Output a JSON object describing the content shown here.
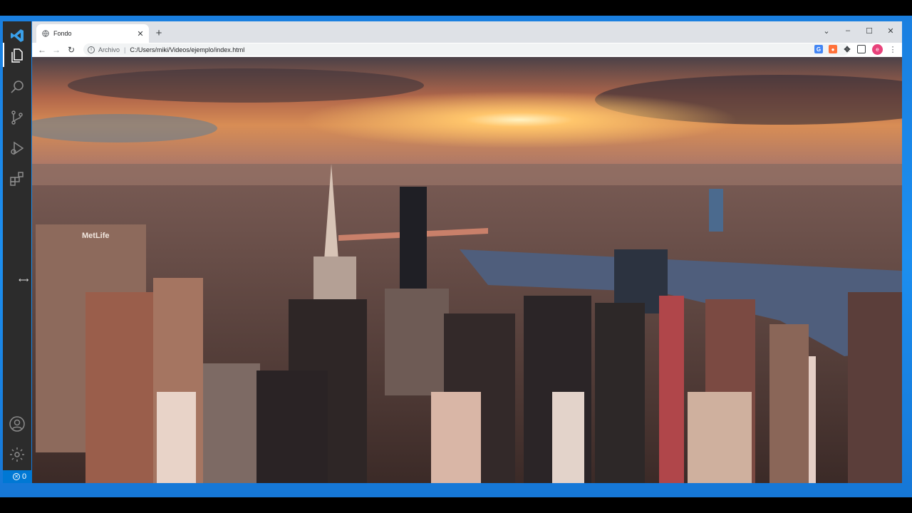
{
  "vscode": {
    "activity_icons": [
      "files-icon",
      "search-icon",
      "source-control-icon",
      "run-debug-icon",
      "extensions-icon",
      "account-icon",
      "settings-gear-icon"
    ],
    "status": {
      "errors": "0"
    },
    "accent": "#0078d4"
  },
  "browser": {
    "tab": {
      "title": "Fondo",
      "favicon": "globe-icon"
    },
    "newtab_symbol": "+",
    "address": {
      "scheme_label": "Archivo",
      "separator": "|",
      "url": "C:/Users/miki/Videos/ejemplo/index.html"
    },
    "profile_initial": "e",
    "window_controls": {
      "dropdown": "⌄",
      "minimize": "–",
      "maximize": "☐",
      "close": "✕"
    }
  },
  "page": {
    "background_scene": "city-skyline-sunset",
    "colors": {
      "sky_top": "#3d3a3f",
      "sun": "#ffd27a",
      "river": "#4a5876"
    }
  }
}
